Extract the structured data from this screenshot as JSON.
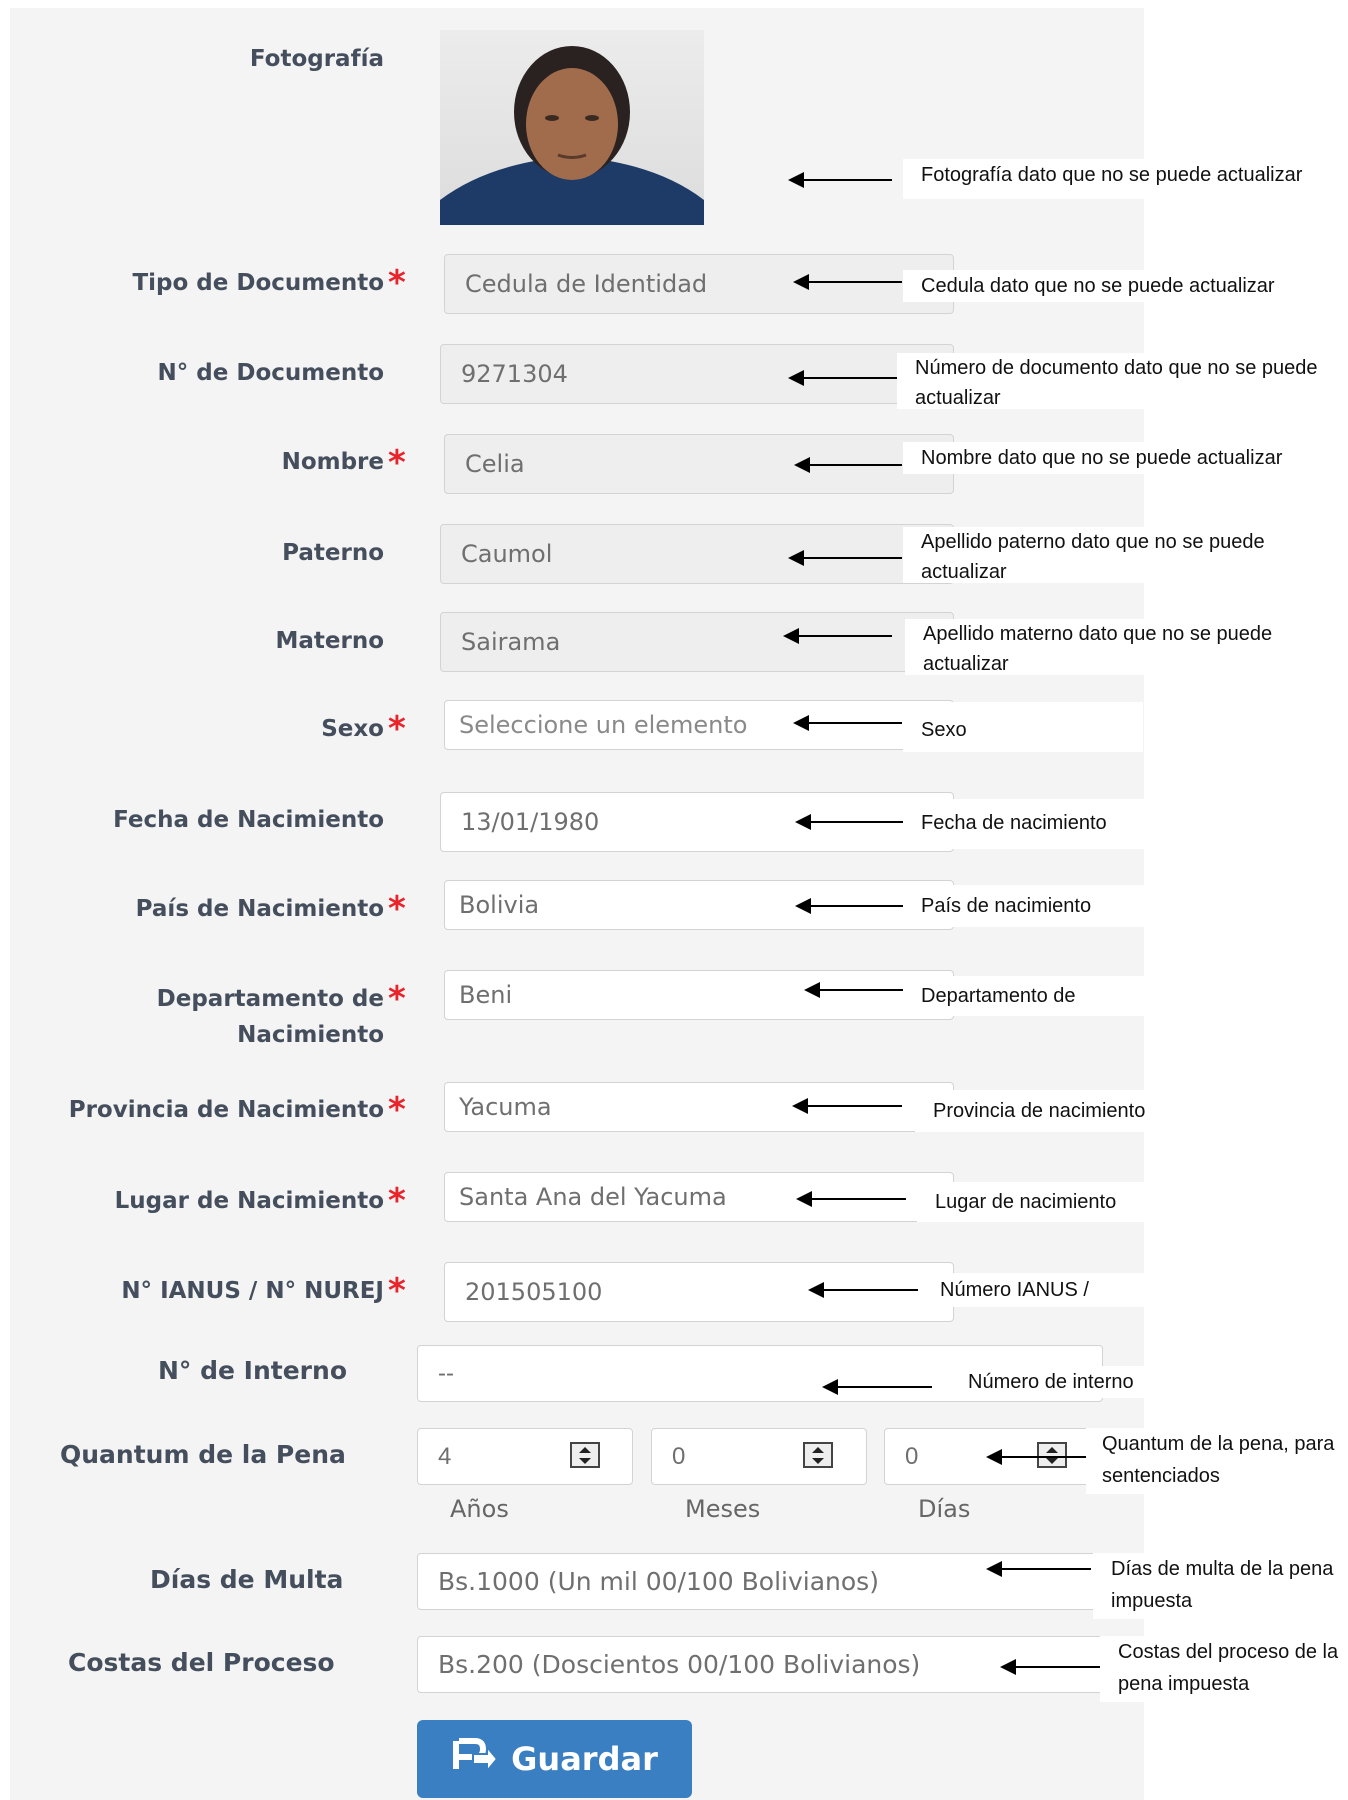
{
  "form": {
    "photo_label": "Fotografía",
    "fields": [
      {
        "label": "Tipo de Documento",
        "value": "Cedula de Identidad",
        "note": "Cedula dato que no se puede actualizar"
      },
      {
        "label": "N° de Documento",
        "value": "9271304",
        "note": "Número de documento dato que no se puede actualizar"
      },
      {
        "label": "Nombre",
        "value": "Celia",
        "note": "Nombre dato que no se puede actualizar"
      },
      {
        "label": "Paterno",
        "value": "Caumol",
        "note": "Apellido paterno dato que no se puede actualizar"
      },
      {
        "label": "Materno",
        "value": "Sairama",
        "note": "Apellido materno dato que no se puede actualizar"
      },
      {
        "label": "Sexo",
        "value": "Seleccione un elemento",
        "note": "Sexo"
      },
      {
        "label": "Fecha de Nacimiento",
        "value": "13/01/1980",
        "note": "Fecha de nacimiento"
      },
      {
        "label": "País de Nacimiento",
        "value": "Bolivia",
        "note": "País de nacimiento"
      },
      {
        "label": "Departamento de",
        "label2": "Nacimiento",
        "value": "Beni",
        "note": "Departamento de nacimiento"
      },
      {
        "label": "Provincia de Nacimiento",
        "value": "Yacuma",
        "note": "Provincia de nacimiento"
      },
      {
        "label": "Lugar de Nacimiento",
        "value": "Santa Ana del Yacuma",
        "note": "Lugar de nacimiento"
      },
      {
        "label": "N° IANUS / N° NUREJ",
        "value": "201505100",
        "note": "Número IANUS / NUREJ"
      },
      {
        "label": "N° de Interno",
        "value": "--",
        "note": "Número de interno"
      }
    ],
    "photo_note": "Fotografía dato que no se puede actualizar",
    "quantum": {
      "label": "Quantum de la Pena",
      "years": "4",
      "months": "0",
      "days": "0",
      "years_label": "Años",
      "months_label": "Meses",
      "days_label": "Días",
      "note": "Quantum de la pena, para sentenciados"
    },
    "multa": {
      "label": "Días de Multa",
      "value": "Bs.1000 (Un mil 00/100 Bolivianos)",
      "note": "Días de multa de la pena impuesta"
    },
    "costas": {
      "label": "Costas del Proceso",
      "value": "Bs.200 (Doscientos 00/100 Bolivianos)",
      "note": "Costas del proceso de la pena impuesta"
    },
    "save_label": "Guardar"
  }
}
